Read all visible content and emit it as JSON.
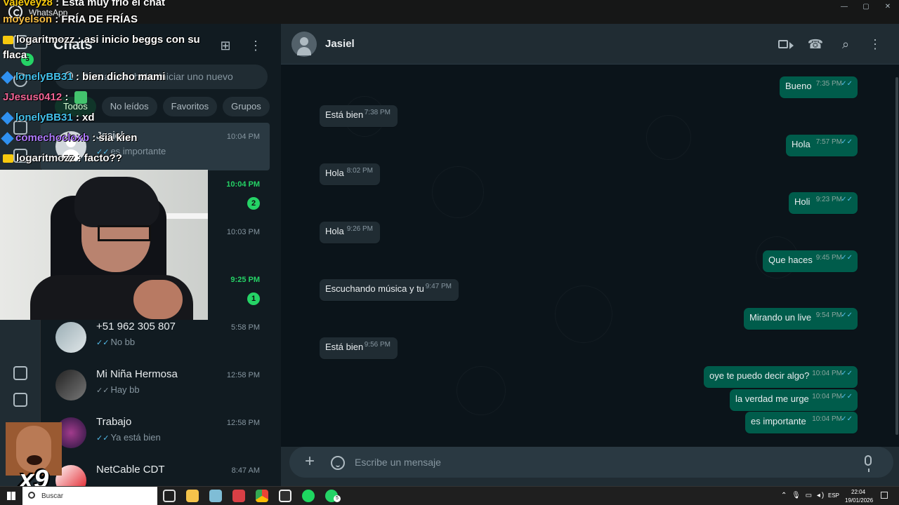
{
  "app": {
    "title": "WhatsApp"
  },
  "window": {
    "controls": [
      "—",
      "▢",
      "✕"
    ]
  },
  "sidebar": {
    "title": "Chats",
    "badge": "5",
    "new_chat_icon": "⊞",
    "menu_icon": "⋮",
    "search_placeholder": "Buscar un chat o iniciar uno nuevo",
    "filters": [
      "Todos",
      "No leídos",
      "Favoritos",
      "Grupos"
    ],
    "chats": [
      {
        "name": "Jasiel",
        "time": "10:04 PM",
        "preview": "es importante",
        "ticks": "✓✓",
        "selected": true
      },
      {
        "name": "",
        "time": "10:04 PM",
        "preview": "",
        "unread": "2",
        "unread_time": true
      },
      {
        "name": "",
        "time": "10:03 PM",
        "preview": ""
      },
      {
        "name": "",
        "time": "9:25 PM",
        "preview": "",
        "unread": "1",
        "unread_time": true
      },
      {
        "name": "+51 962 305 807",
        "time": "5:58 PM",
        "preview": "No bb",
        "ticks": "✓✓"
      },
      {
        "name": "Mi Niña Hermosa",
        "time": "12:58 PM",
        "preview": "Hay bb",
        "ticks": "✓✓"
      },
      {
        "name": "Trabajo",
        "time": "12:58 PM",
        "preview": "Ya está bien",
        "ticks": "✓✓"
      },
      {
        "name": "NetCable CDT",
        "time": "8:47 AM",
        "preview": ""
      }
    ]
  },
  "conversation": {
    "contact": "Jasiel",
    "icons": {
      "video": "video-icon",
      "call": "☎",
      "search": "⌕",
      "menu": "⋮"
    },
    "messages": [
      {
        "dir": "out",
        "text": "Bueno",
        "time": "7:35 PM"
      },
      {
        "dir": "in",
        "text": "Está bien",
        "time": "7:38 PM"
      },
      {
        "dir": "out",
        "text": "Hola",
        "time": "7:57 PM"
      },
      {
        "dir": "in",
        "text": "Hola",
        "time": "8:02 PM"
      },
      {
        "dir": "out",
        "text": "Holi",
        "time": "9:23 PM"
      },
      {
        "dir": "in",
        "text": "Hola",
        "time": "9:26 PM"
      },
      {
        "dir": "out",
        "text": "Que haces",
        "time": "9:45 PM"
      },
      {
        "dir": "in",
        "text": "Escuchando música y tu",
        "time": "9:47 PM"
      },
      {
        "dir": "out",
        "text": "Mirando un live",
        "time": "9:54 PM"
      },
      {
        "dir": "in",
        "text": "Está bien",
        "time": "9:56 PM"
      },
      {
        "dir": "out",
        "text": "oye te puedo decir algo?",
        "time": "10:04 PM"
      },
      {
        "dir": "out",
        "text": "la verdad me urge",
        "time": "10:04 PM"
      },
      {
        "dir": "out",
        "text": "es importante",
        "time": "10:04 PM"
      }
    ],
    "read_ticks": "✓✓",
    "composer_placeholder": "Escribe un mensaje"
  },
  "stream_chat": {
    "lines": [
      {
        "user": "Valeveyz8",
        "message": "Esta muy frío el chat",
        "color": "#f6c90e",
        "badge": ""
      },
      {
        "user": "moyelson",
        "message": "FRÍA DE FRÍAS",
        "color": "#f4bd45",
        "badge": ""
      },
      {
        "user": "logaritmozz",
        "message": "asi inicio beggs con su flaca",
        "color": "#f2f2f2",
        "badge": "crown"
      },
      {
        "user": "lonelyBB31",
        "message": "bien dicho mami",
        "color": "#44c2ed",
        "badge": "cube"
      },
      {
        "user": "JJesus0412",
        "message": "",
        "color": "#f06495",
        "badge": "emote"
      },
      {
        "user": "lonelyBB31",
        "message": "xd",
        "color": "#44c2ed",
        "badge": "cube"
      },
      {
        "user": "comechocloxb",
        "message": "sia kien",
        "color": "#b07cff",
        "badge": "cube"
      },
      {
        "user": "logaritmozz",
        "message": "facto??",
        "color": "#f2f2f2",
        "badge": "crown"
      }
    ]
  },
  "overlay": {
    "meme_count": "x9"
  },
  "taskbar": {
    "search_label": "Buscar",
    "apps": [
      "task-view",
      "files",
      "notes",
      "tool",
      "chrome",
      "obs",
      "spotify",
      "whatsapp"
    ],
    "app_badge": "5",
    "tray_icons": "⌃ 🎙 ▭ ◂)",
    "language": "ESP",
    "time": "22:04",
    "date": "19/01/2026"
  },
  "colors": {
    "accent": "#25d366",
    "outgoing_bubble": "#005c4b",
    "incoming_bubble": "#202c33",
    "read_tick": "#53bdeb"
  }
}
